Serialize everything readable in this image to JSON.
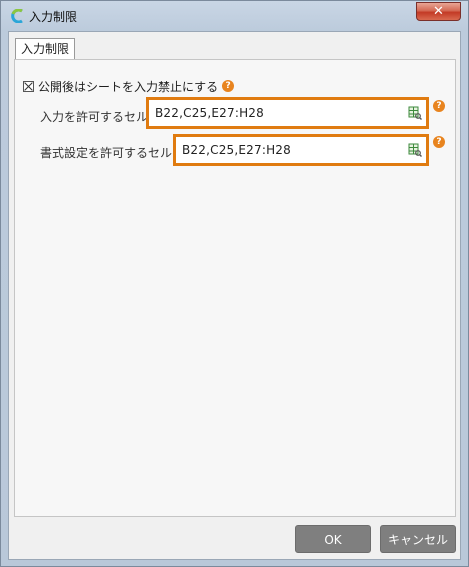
{
  "window": {
    "title": "入力制限",
    "close_label": "✕",
    "app_icon": "app-logo-icon"
  },
  "tabs": [
    {
      "label": "入力制限",
      "selected": true
    }
  ],
  "lock": {
    "checked": true,
    "label": "公開後はシートを入力禁止にする",
    "help_label": "?"
  },
  "fields": {
    "input_allowed": {
      "label": "入力を許可するセル",
      "value": "B22,C25,E27:H28",
      "help_label": "?",
      "picker_icon": "range-picker-icon"
    },
    "format_allowed": {
      "label": "書式設定を許可するセル",
      "value": "B22,C25,E27:H28",
      "help_label": "?",
      "picker_icon": "range-picker-icon"
    }
  },
  "buttons": {
    "ok": "OK",
    "cancel": "キャンセル"
  },
  "colors": {
    "highlight": "#e07b10",
    "help": "#e8841f",
    "button": "#7f7f7f"
  }
}
